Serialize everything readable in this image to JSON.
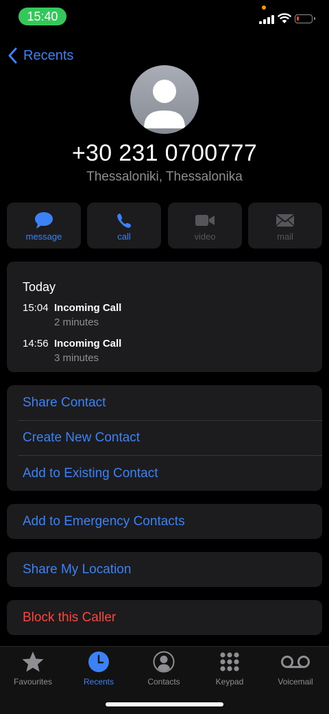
{
  "status": {
    "time": "15:40"
  },
  "nav": {
    "back_label": "Recents"
  },
  "contact": {
    "number": "+30 231 0700777",
    "location": "Thessaloniki, Thessalonika"
  },
  "actions": [
    {
      "label": "message",
      "enabled": true
    },
    {
      "label": "call",
      "enabled": true
    },
    {
      "label": "video",
      "enabled": false
    },
    {
      "label": "mail",
      "enabled": false
    }
  ],
  "calls": {
    "heading": "Today",
    "entries": [
      {
        "time": "15:04",
        "type": "Incoming Call",
        "duration": "2 minutes"
      },
      {
        "time": "14:56",
        "type": "Incoming Call",
        "duration": "3 minutes"
      }
    ]
  },
  "options": {
    "share_contact": "Share Contact",
    "create_new_contact": "Create New Contact",
    "add_to_existing": "Add to Existing Contact",
    "add_emergency": "Add to Emergency Contacts",
    "share_location": "Share My Location",
    "block_caller": "Block this Caller"
  },
  "tabs": [
    {
      "label": "Favourites",
      "icon": "star-icon"
    },
    {
      "label": "Recents",
      "icon": "clock-icon",
      "selected": true
    },
    {
      "label": "Contacts",
      "icon": "person-circle-icon"
    },
    {
      "label": "Keypad",
      "icon": "keypad-icon"
    },
    {
      "label": "Voicemail",
      "icon": "voicemail-icon"
    }
  ],
  "colors": {
    "accent": "#3b82f6",
    "destructive": "#ff453a",
    "status_pill": "#34c759"
  }
}
